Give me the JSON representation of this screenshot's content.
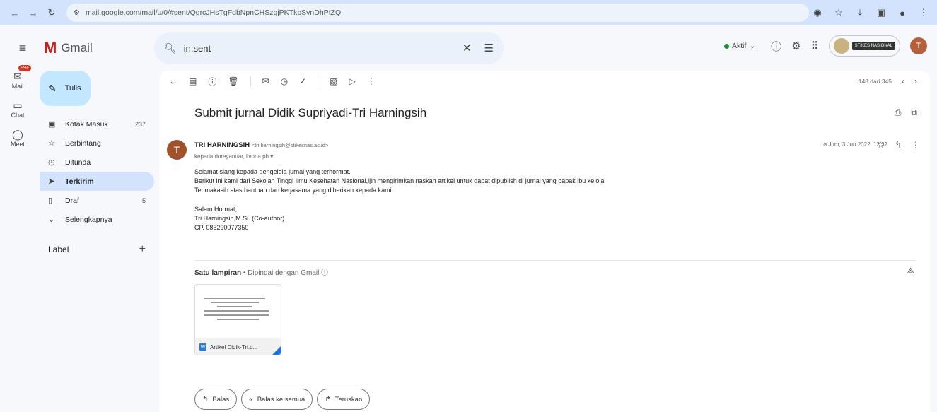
{
  "browser": {
    "url": "mail.google.com/mail/u/0/#sent/QgrcJHsTgFdbNpnCHSzgjPKTkpSvnDhPtZQ"
  },
  "gmail": {
    "app_name": "Gmail",
    "search_value": "in:sent",
    "status_label": "Aktif",
    "avatar_initial": "T",
    "org_badge": "STIKES NASIONAL"
  },
  "rail": [
    {
      "label": "Mail",
      "badge": "99+"
    },
    {
      "label": "Chat"
    },
    {
      "label": "Meet"
    }
  ],
  "sidebar": {
    "compose_label": "Tulis",
    "folders": [
      {
        "label": "Kotak Masuk",
        "count": "237",
        "icon": "inbox-icon"
      },
      {
        "label": "Berbintang",
        "count": "",
        "icon": "star-icon"
      },
      {
        "label": "Ditunda",
        "count": "",
        "icon": "clock-icon"
      },
      {
        "label": "Terkirim",
        "count": "",
        "icon": "send-icon"
      },
      {
        "label": "Draf",
        "count": "5",
        "icon": "draft-icon"
      },
      {
        "label": "Selengkapnya",
        "count": "",
        "icon": "chevron-down-icon"
      }
    ],
    "label_heading": "Label"
  },
  "pager": {
    "text": "148 dari 345"
  },
  "email": {
    "subject": "Submit jurnal Didik Supriyadi-Tri Harningsih",
    "sender_name": "TRI HARNINGSIH",
    "sender_email": "<tri.harningsih@stikesnas.ac.id>",
    "to_line": "kepada doreyanuar, livona.ph",
    "date": "Jum, 3 Jun 2022, 12.32",
    "body": [
      "Selamat siang kepada pengelola jurnal yang terhormat.",
      "Berikut ini kami dari Sekolah Tinggi Ilmu Kesehatan Nasional,ijin mengirimkan naskah artikel untuk dapat dipublish di jurnal yang bapak ibu kelola.",
      "Terimakasih atas bantuan dan kerjasama yang diberikan kepada kami"
    ],
    "signature": [
      "Salam Hormat,",
      "Tri Harningsih,M.Si. (Co-author)",
      "CP. 085290077350"
    ]
  },
  "attachments": {
    "heading": "Satu lampiran",
    "scan_note": "Dipindai dengan Gmail",
    "file_name": "Artikel Didik-Tri.d..."
  },
  "actions": {
    "reply": "Balas",
    "reply_all": "Balas ke semua",
    "forward": "Teruskan"
  }
}
